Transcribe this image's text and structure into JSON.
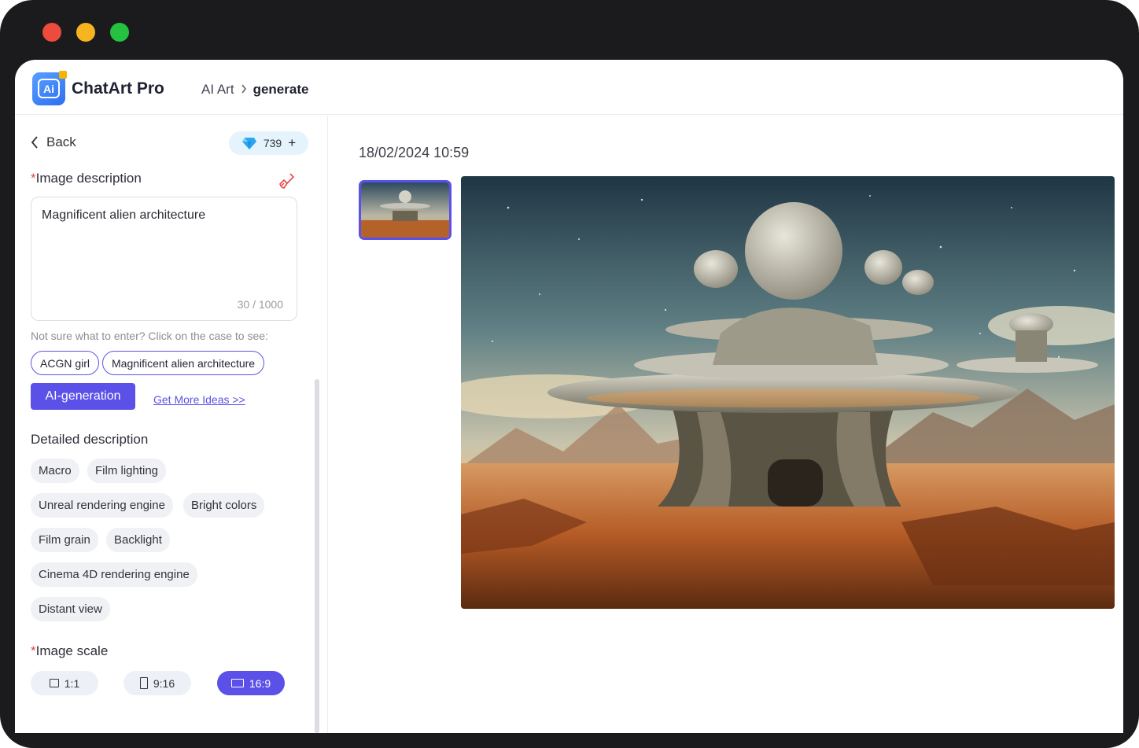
{
  "window": {
    "traffic_lights": [
      "#ed4c3c",
      "#f6b51e",
      "#25c141"
    ]
  },
  "header": {
    "logo_text": "Ai",
    "app_title": "ChatArt Pro",
    "breadcrumb": [
      "AI Art",
      "generate"
    ]
  },
  "sidebar": {
    "back_label": "Back",
    "credits": "739",
    "description_label": "Image description",
    "description_value": "Magnificent alien architecture",
    "char_count": "30 / 1000",
    "hint": "Not sure what to enter? Click on the case to see:",
    "cases": [
      "ACGN girl",
      "Magnificent alien architecture"
    ],
    "ai_button": "AI-generation",
    "more_ideas": "Get More Ideas >>",
    "detailed_label": "Detailed description",
    "tags": [
      "Macro",
      "Film lighting",
      "Unreal rendering engine",
      "Bright colors",
      "Film grain",
      "Backlight",
      "Cinema 4D rendering engine",
      "Distant view"
    ],
    "scale_label": "Image scale",
    "scales": [
      "1:1",
      "9:16",
      "16:9"
    ],
    "active_scale": "16:9"
  },
  "main": {
    "timestamp": "18/02/2024 10:59"
  },
  "colors": {
    "accent": "#5b50e8",
    "required": "#e84545"
  }
}
